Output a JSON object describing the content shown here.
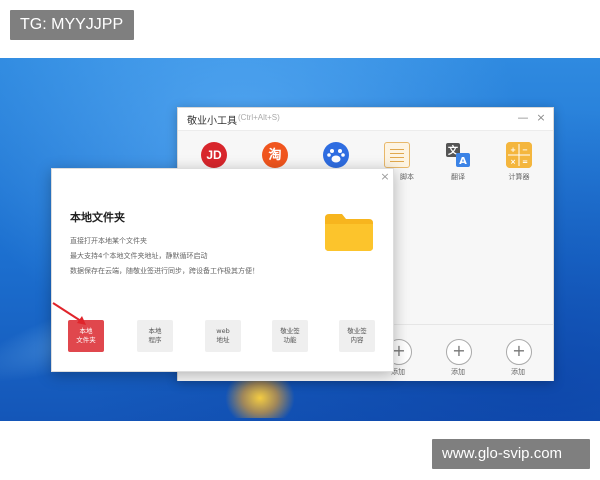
{
  "watermarks": {
    "top": "TG: MYYJJPP",
    "bottom": "www.glo-svip.com"
  },
  "main_window": {
    "title": "敬业小工具",
    "subtitle": "(Ctrl+Alt+S)",
    "minimize_icon": "minimize-icon",
    "close_icon": "close-icon",
    "apps": [
      {
        "name": "JD",
        "label": ""
      },
      {
        "name": "淘",
        "label": ""
      },
      {
        "name": "baidu-paw-icon",
        "label": ""
      },
      {
        "name": "notes-icon",
        "label": "脚本"
      },
      {
        "name": "translate-icon",
        "label": "翻译"
      },
      {
        "name": "calculator-icon",
        "label": "计算器"
      }
    ],
    "add_slots": [
      {
        "symbol": "+",
        "label": "添加"
      },
      {
        "symbol": "+",
        "label": "添加"
      },
      {
        "symbol": "+",
        "label": "添加"
      }
    ]
  },
  "dialog": {
    "close": "×",
    "title": "本地文件夹",
    "lines": [
      "直接打开本地某个文件夹",
      "最大支持4个本地文件夹地址，静默循环启动",
      "数据保存在云端，随敬业签进行同步，跨设备工作极其方便！"
    ],
    "tabs": [
      {
        "line1": "本地",
        "line2": "文件夹",
        "active": true
      },
      {
        "line1": "本地",
        "line2": "程序",
        "active": false
      },
      {
        "line1": "web",
        "line2": "地址",
        "active": false
      },
      {
        "line1": "敬业签",
        "line2": "功能",
        "active": false
      },
      {
        "line1": "敬业签",
        "line2": "内容",
        "active": false
      }
    ]
  },
  "colors": {
    "accent_red": "#e0474d",
    "folder_yellow": "#fcc42c",
    "desktop_blue": "#1c6fcf"
  }
}
